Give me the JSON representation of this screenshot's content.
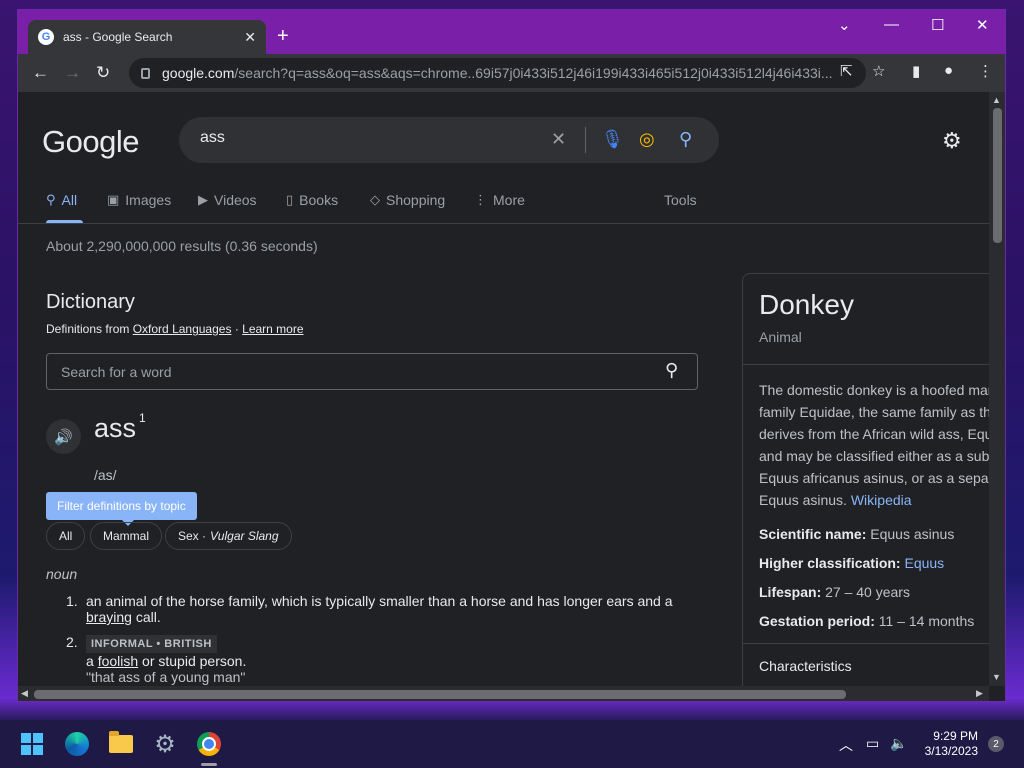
{
  "browser": {
    "tab_title": "ass - Google Search",
    "favicon_letter": "G",
    "url_host": "google.com",
    "url_path": "/search?q=ass&oq=ass&aqs=chrome..69i57j0i433i512j46i199i433i465i512j0i433i512l4j46i433i..."
  },
  "search": {
    "logo": "Google",
    "query": "ass",
    "tabs": [
      {
        "label": "All",
        "icon": "search-icon"
      },
      {
        "label": "Images",
        "icon": "image-icon"
      },
      {
        "label": "Videos",
        "icon": "video-icon"
      },
      {
        "label": "Books",
        "icon": "book-icon"
      },
      {
        "label": "Shopping",
        "icon": "tag-icon"
      },
      {
        "label": "More",
        "icon": "dots-icon"
      }
    ],
    "tools_label": "Tools",
    "result_stats": "About 2,290,000,000 results (0.36 seconds)"
  },
  "dictionary": {
    "title": "Dictionary",
    "source_prefix": "Definitions from",
    "source_name": "Oxford Languages",
    "separator": "·",
    "learn_more": "Learn more",
    "search_placeholder": "Search for a word",
    "word": "ass",
    "superscript": "1",
    "phonetic": "/as/",
    "filter_label": "Filter definitions by topic",
    "chips": [
      {
        "label": "All"
      },
      {
        "label": "Mammal"
      },
      {
        "label": "Sex ·",
        "italic": "Vulgar Slang"
      }
    ],
    "part_of_speech": "noun",
    "definitions": [
      {
        "num": "1.",
        "text_a": "an animal of the horse family, which is typically smaller than a horse and has longer ears and a",
        "link": "braying",
        "text_b": "call."
      },
      {
        "num": "2.",
        "tag": "INFORMAL • BRITISH",
        "text_a": "a",
        "link": "foolish",
        "text_b": "or stupid person.",
        "example": "\"that ass of a young man\""
      }
    ]
  },
  "knowledge_panel": {
    "title": "Donkey",
    "subtitle": "Animal",
    "description_lines": [
      "The domestic donkey is a hoofed mam",
      "family Equidae, the same family as th",
      "derives from the African wild ass, Equ",
      "and may be classified either as a sub",
      "Equus africanus asinus, or as a separ",
      "Equus asinus."
    ],
    "wiki_link": "Wikipedia",
    "facts": [
      {
        "label": "Scientific name:",
        "value": "Equus asinus"
      },
      {
        "label": "Higher classification:",
        "link": "Equus"
      },
      {
        "label": "Lifespan:",
        "value": "27 – 40 years"
      },
      {
        "label": "Gestation period:",
        "value": "11 – 14 months"
      }
    ],
    "characteristics": "Characteristics"
  },
  "taskbar": {
    "time": "9:29 PM",
    "date": "3/13/2023",
    "notification_count": "2"
  },
  "colors": {
    "link": "#8ab4f8",
    "page_bg": "#202124",
    "titlebar": "#7a1fa8"
  }
}
